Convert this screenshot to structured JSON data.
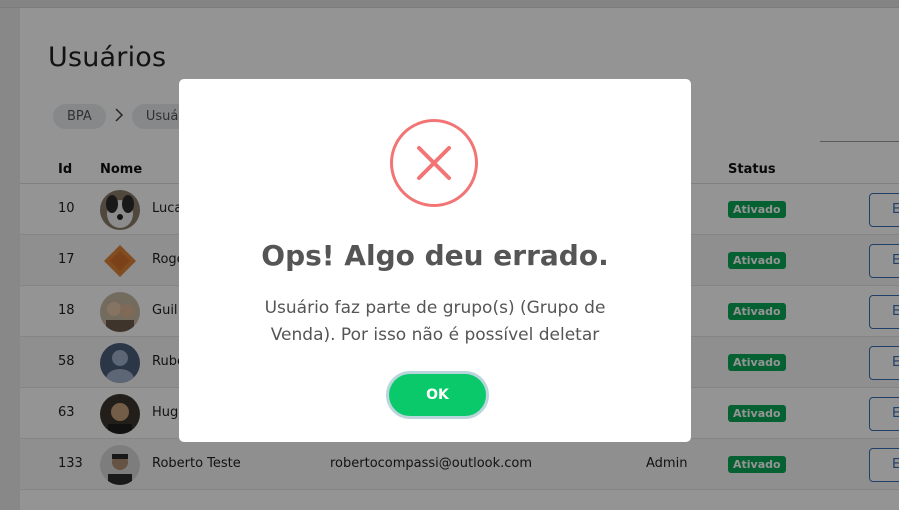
{
  "page": {
    "title": "Usuários"
  },
  "breadcrumb": [
    "BPA",
    "Usuários"
  ],
  "table": {
    "headers": {
      "id": "Id",
      "nome": "Nome",
      "status": "Status"
    },
    "rows": [
      {
        "id": "10",
        "nome": "Luca",
        "email": "",
        "perfil": "",
        "status": "Ativado",
        "action": "E"
      },
      {
        "id": "17",
        "nome": "Roge",
        "email": "",
        "perfil": "",
        "status": "Ativado",
        "action": "E"
      },
      {
        "id": "18",
        "nome": "Guil",
        "email": "",
        "perfil": "",
        "status": "Ativado",
        "action": "E"
      },
      {
        "id": "58",
        "nome": "Rube",
        "email": "",
        "perfil": "",
        "status": "Ativado",
        "action": "E"
      },
      {
        "id": "63",
        "nome": "Hug",
        "email": "",
        "perfil": "",
        "status": "Ativado",
        "action": "E"
      },
      {
        "id": "133",
        "nome": "Roberto Teste",
        "email": "robertocompassi@outlook.com",
        "perfil": "Admin",
        "status": "Ativado",
        "action": "E"
      }
    ]
  },
  "modal": {
    "title": "Ops! Algo deu errado.",
    "message": "Usuário faz parte de grupo(s) (Grupo de Venda). Por isso não é possível deletar",
    "ok_label": "OK",
    "icon": "error-x-icon"
  },
  "colors": {
    "error": "#f27474",
    "ok_button": "#0ac96a",
    "status_badge": "#0aa857",
    "action_border": "#3a6fb5"
  }
}
